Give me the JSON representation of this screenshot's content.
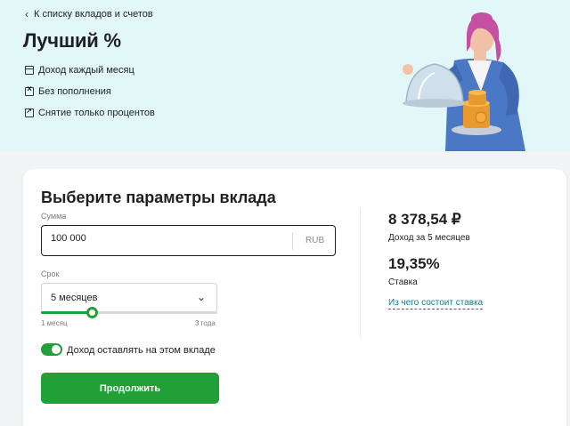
{
  "hero": {
    "back_link": "К списку вкладов и счетов",
    "title": "Лучший %",
    "features": [
      {
        "icon": "calendar-icon",
        "label": "Доход каждый месяц"
      },
      {
        "icon": "no-replenish-icon",
        "label": "Без пополнения"
      },
      {
        "icon": "withdraw-icon",
        "label": "Снятие только процентов"
      }
    ]
  },
  "form": {
    "title": "Выберите параметры вклада",
    "amount": {
      "label": "Сумма",
      "value": "100 000",
      "currency": "RUB"
    },
    "term": {
      "label": "Срок",
      "selected": "5 месяцев",
      "min_label": "1 месяц",
      "max_label": "3 года",
      "slider_progress": 0.29
    },
    "toggle": {
      "label": "Доход оставлять на этом вкладе",
      "on": true
    },
    "submit_label": "Продолжить"
  },
  "summary": {
    "income_value": "8 378,54 ₽",
    "income_label": "Доход за 5 месяцев",
    "rate_value": "19,35%",
    "rate_label": "Ставка",
    "rate_link": "Из чего состоит ставка"
  },
  "colors": {
    "accent": "#21a038",
    "hero_bg": "#e2f7f8",
    "link": "#107f8c"
  }
}
